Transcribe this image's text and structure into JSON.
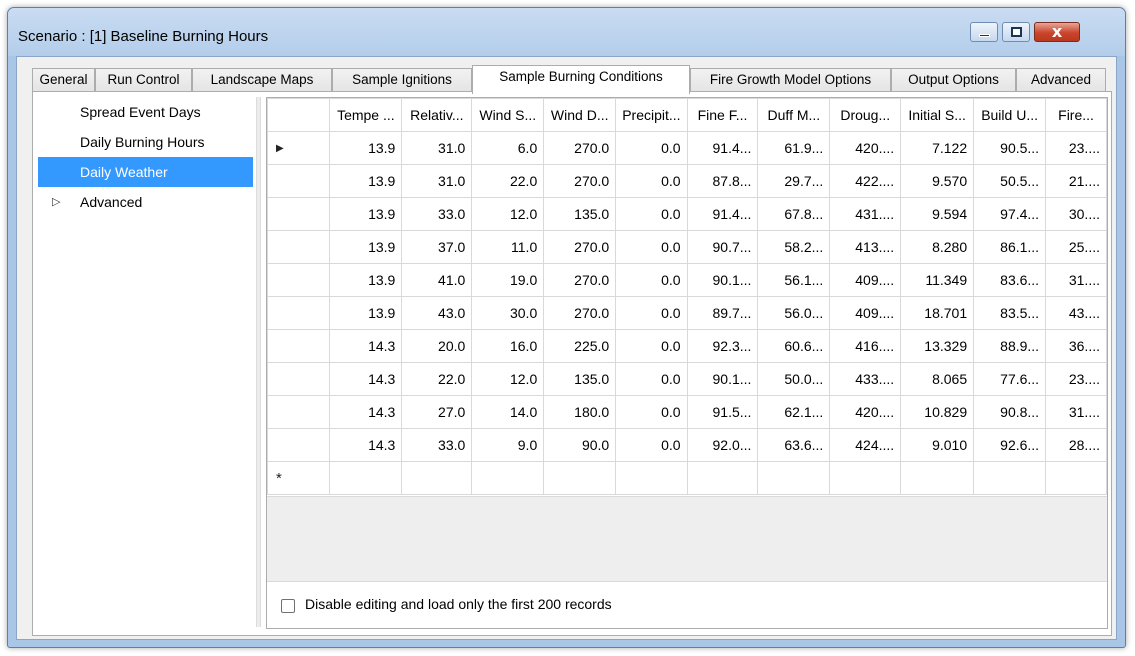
{
  "window": {
    "title": "Scenario : [1] Baseline Burning Hours",
    "min_glyph": "minimize-icon",
    "max_glyph": "maximize-icon",
    "close_glyph": "x"
  },
  "tabs": [
    {
      "label": "General",
      "active": false
    },
    {
      "label": "Run Control",
      "active": false
    },
    {
      "label": "Landscape Maps",
      "active": false
    },
    {
      "label": "Sample Ignitions",
      "active": false
    },
    {
      "label": "Sample Burning Conditions",
      "active": true
    },
    {
      "label": "Fire Growth Model Options",
      "active": false
    },
    {
      "label": "Output Options",
      "active": false
    },
    {
      "label": "Advanced",
      "active": false
    }
  ],
  "tree": {
    "items": [
      {
        "label": "Spread Event Days",
        "selected": false
      },
      {
        "label": "Daily Burning Hours",
        "selected": false
      },
      {
        "label": "Daily Weather",
        "selected": true
      },
      {
        "label": "Advanced",
        "selected": false,
        "expander": "▷"
      }
    ]
  },
  "grid": {
    "columns": [
      "Tempe ...",
      "Relativ...",
      "Wind S...",
      "Wind D...",
      "Precipit...",
      "Fine F...",
      "Duff M...",
      "Droug...",
      "Initial S...",
      "Build U...",
      "Fire..."
    ],
    "rows": [
      [
        "13.9",
        "31.0",
        "6.0",
        "270.0",
        "0.0",
        "91.4...",
        "61.9...",
        "420....",
        "7.122",
        "90.5...",
        "23...."
      ],
      [
        "13.9",
        "31.0",
        "22.0",
        "270.0",
        "0.0",
        "87.8...",
        "29.7...",
        "422....",
        "9.570",
        "50.5...",
        "21...."
      ],
      [
        "13.9",
        "33.0",
        "12.0",
        "135.0",
        "0.0",
        "91.4...",
        "67.8...",
        "431....",
        "9.594",
        "97.4...",
        "30...."
      ],
      [
        "13.9",
        "37.0",
        "11.0",
        "270.0",
        "0.0",
        "90.7...",
        "58.2...",
        "413....",
        "8.280",
        "86.1...",
        "25...."
      ],
      [
        "13.9",
        "41.0",
        "19.0",
        "270.0",
        "0.0",
        "90.1...",
        "56.1...",
        "409....",
        "11.349",
        "83.6...",
        "31...."
      ],
      [
        "13.9",
        "43.0",
        "30.0",
        "270.0",
        "0.0",
        "89.7...",
        "56.0...",
        "409....",
        "18.701",
        "83.5...",
        "43...."
      ],
      [
        "14.3",
        "20.0",
        "16.0",
        "225.0",
        "0.0",
        "92.3...",
        "60.6...",
        "416....",
        "13.329",
        "88.9...",
        "36...."
      ],
      [
        "14.3",
        "22.0",
        "12.0",
        "135.0",
        "0.0",
        "90.1...",
        "50.0...",
        "433....",
        "8.065",
        "77.6...",
        "23...."
      ],
      [
        "14.3",
        "27.0",
        "14.0",
        "180.0",
        "0.0",
        "91.5...",
        "62.1...",
        "420....",
        "10.829",
        "90.8...",
        "31...."
      ],
      [
        "14.3",
        "33.0",
        "9.0",
        "90.0",
        "0.0",
        "92.0...",
        "63.6...",
        "424....",
        "9.010",
        "92.6...",
        "28...."
      ]
    ],
    "current_row_marker": "▶",
    "new_row_marker": "*"
  },
  "footer": {
    "checkbox_label": "Disable editing and load only the first 200 records",
    "checked": false
  }
}
